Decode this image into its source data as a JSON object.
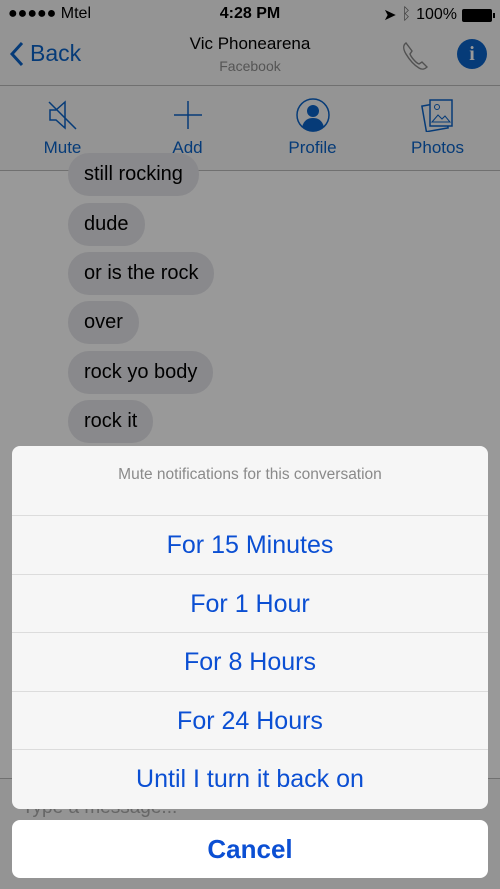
{
  "status_bar": {
    "carrier": "●●●●● Mtel",
    "time": "4:28 PM",
    "battery": "100%"
  },
  "nav": {
    "back_label": "Back",
    "title": "Vic Phonearena",
    "subtitle": "Facebook"
  },
  "toolbar": {
    "items": [
      {
        "label": "Mute",
        "icon": "speaker-muted-icon"
      },
      {
        "label": "Add",
        "icon": "plus-icon"
      },
      {
        "label": "Profile",
        "icon": "profile-icon"
      },
      {
        "label": "Photos",
        "icon": "photos-icon"
      }
    ]
  },
  "messages": [
    "still rocking",
    "dude",
    "or is the rock",
    "over",
    "rock yo body",
    "rock it"
  ],
  "input": {
    "placeholder": "Type a message..."
  },
  "action_sheet": {
    "title": "Mute notifications for this conversation",
    "options": [
      "For 15 Minutes",
      "For 1 Hour",
      "For 8 Hours",
      "For 24 Hours",
      "Until I turn it back on"
    ],
    "cancel_label": "Cancel"
  },
  "colors": {
    "accent": "#0a63c8",
    "sheet_text": "#0b4fd3"
  }
}
